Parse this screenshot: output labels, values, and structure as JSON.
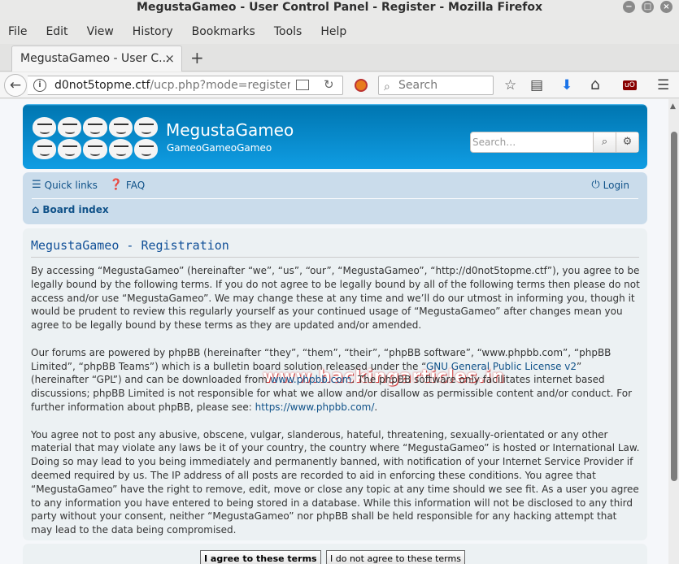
{
  "window": {
    "title": "MegustaGameo - User Control Panel - Register - Mozilla Firefox",
    "minimize": "−",
    "maximize": "□",
    "close": "×"
  },
  "menu": [
    "File",
    "Edit",
    "View",
    "History",
    "Bookmarks",
    "Tools",
    "Help"
  ],
  "tab": {
    "title": "MegustaGameo - User C...",
    "close": "×",
    "new_tab": "+"
  },
  "nav": {
    "back": "←",
    "url_host": "d0not5topme.ctf",
    "url_path": "/ucp.php?mode=register&",
    "reload": "↻",
    "search_placeholder": "Search",
    "bookmark_star": "☆",
    "library": "▤",
    "download": "⬇",
    "home": "⌂",
    "ublock": "uO",
    "hamburger": "☰"
  },
  "site": {
    "name": "MegustaGameo",
    "description": "GameoGameoGameo",
    "search_placeholder": "Search…"
  },
  "navbar": {
    "quick_links": "Quick links",
    "faq": "FAQ",
    "login": "Login",
    "board_index": "Board index"
  },
  "content": {
    "title": "MegustaGameo - Registration",
    "watermark": "www.hackingarticles.in",
    "p1": "By accessing “MegustaGameo” (hereinafter “we”, “us”, “our”, “MegustaGameo”, “http://d0not5topme.ctf”), you agree to be legally bound by the following terms. If you do not agree to be legally bound by all of the following terms then please do not access and/or use “MegustaGameo”. We may change these at any time and we’ll do our utmost in informing you, though it would be prudent to review this regularly yourself as your continued usage of “MegustaGameo” after changes mean you agree to be legally bound by these terms as they are updated and/or amended.",
    "p2_a": "Our forums are powered by phpBB (hereinafter “they”, “them”, “their”, “phpBB software”, “www.phpbb.com”, “phpBB Limited”, “phpBB Teams”) which is a bulletin board solution released under the “",
    "p2_link1": "GNU General Public License v2",
    "p2_b": "” (hereinafter “GPL”) and can be downloaded from ",
    "p2_link2": "www.phpbb.com",
    "p2_c": ". The phpBB software only facilitates internet based discussions; phpBB Limited is not responsible for what we allow and/or disallow as permissible content and/or conduct. For further information about phpBB, please see: ",
    "p2_link3": "https://www.phpbb.com/",
    "p2_d": ".",
    "p3": "You agree not to post any abusive, obscene, vulgar, slanderous, hateful, threatening, sexually-orientated or any other material that may violate any laws be it of your country, the country where “MegustaGameo” is hosted or International Law. Doing so may lead to you being immediately and permanently banned, with notification of your Internet Service Provider if deemed required by us. The IP address of all posts are recorded to aid in enforcing these conditions. You agree that “MegustaGameo” have the right to remove, edit, move or close any topic at any time should we see fit. As a user you agree to any information you have entered to being stored in a database. While this information will not be disclosed to any third party without your consent, neither “MegustaGameo” nor phpBB shall be held responsible for any hacking attempt that may lead to the data being compromised."
  },
  "buttons": {
    "agree": "I agree to these terms",
    "disagree": "I do not agree to these terms"
  }
}
